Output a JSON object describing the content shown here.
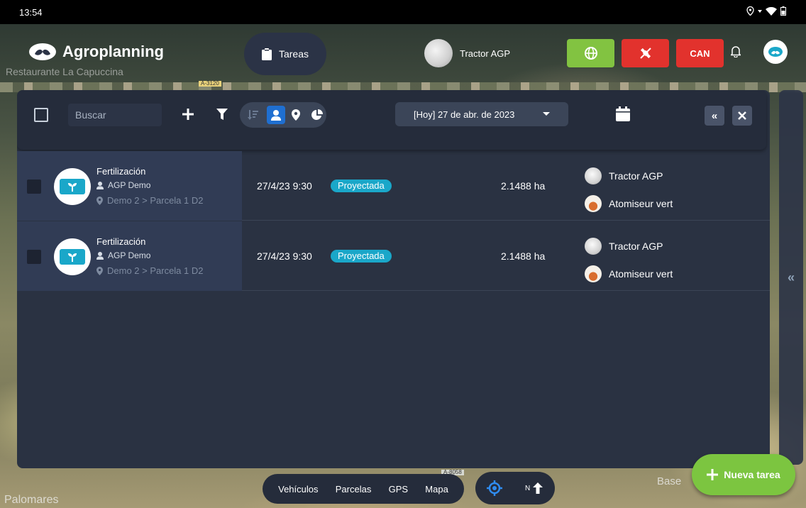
{
  "status_bar": {
    "time": "13:54"
  },
  "app": {
    "brand": "Agroplanning"
  },
  "header": {
    "tasks_label": "Tareas",
    "vehicle_name": "Tractor AGP",
    "can_label": "CAN"
  },
  "colors": {
    "green": "#82c341",
    "red": "#e2322d",
    "accent_blue": "#1aa7c9",
    "panel": "#2a3242",
    "fab": "#7cc540"
  },
  "toolbar": {
    "search_placeholder": "Buscar",
    "date_label": "[Hoy] 27 de abr. de 2023",
    "icons": [
      "add-icon",
      "filter-icon",
      "sort-icon",
      "user-icon",
      "location-icon",
      "pie-chart-icon",
      "calendar-icon",
      "collapse-icon",
      "close-icon"
    ]
  },
  "tasks": [
    {
      "title": "Fertilización",
      "user": "AGP Demo",
      "location": "Demo 2 > Parcela 1 D2",
      "datetime": "27/4/23 9:30",
      "status": "Proyectada",
      "area": "2.1488 ha",
      "vehicle": "Tractor AGP",
      "implement": "Atomiseur vert"
    },
    {
      "title": "Fertilización",
      "user": "AGP Demo",
      "location": "Demo 2 > Parcela 1 D2",
      "datetime": "27/4/23 9:30",
      "status": "Proyectada",
      "area": "2.1488 ha",
      "vehicle": "Tractor AGP",
      "implement": "Atomiseur vert"
    }
  ],
  "bottom_nav": {
    "items": [
      "Vehículos",
      "Parcelas",
      "GPS",
      "Mapa"
    ],
    "north_label": "N"
  },
  "fab": {
    "label": "Nueva tarea"
  },
  "map_labels": [
    "Restaurante La Capuccina",
    "Palomares",
    "Base",
    "A-3120",
    "A-8058"
  ]
}
